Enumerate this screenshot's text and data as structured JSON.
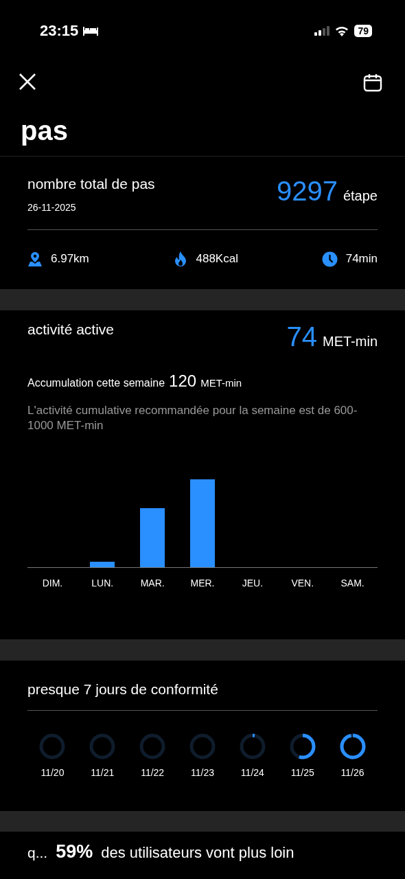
{
  "status_bar": {
    "time": "23:15",
    "battery": "79"
  },
  "header": {
    "title": "pas"
  },
  "steps": {
    "title": "nombre total de pas",
    "date": "26-11-2025",
    "value": "9297",
    "unit": "étape",
    "stats": [
      {
        "kind": "distance",
        "value": "6.97km"
      },
      {
        "kind": "calories",
        "value": "488Kcal"
      },
      {
        "kind": "duration",
        "value": "74min"
      }
    ]
  },
  "activity": {
    "title": "activité active",
    "value": "74",
    "unit": "MET-min",
    "week_label": "Accumulation cette semaine",
    "week_value": "120",
    "week_unit": "MET-min",
    "note": "L'activité cumulative recommandée pour la semaine est de 600-1000 MET-min",
    "days": [
      "DIM.",
      "LUN.",
      "MAR.",
      "MER.",
      "JEU.",
      "VEN.",
      "SAM."
    ]
  },
  "compliance": {
    "title": "presque 7 jours de conformité",
    "days": [
      {
        "date": "11/20"
      },
      {
        "date": "11/21"
      },
      {
        "date": "11/22"
      },
      {
        "date": "11/23"
      },
      {
        "date": "11/24"
      },
      {
        "date": "11/25"
      },
      {
        "date": "11/26"
      }
    ]
  },
  "footer": {
    "prefix": "q...",
    "percent": "59%",
    "text": "des utilisateurs vont plus loin"
  }
}
